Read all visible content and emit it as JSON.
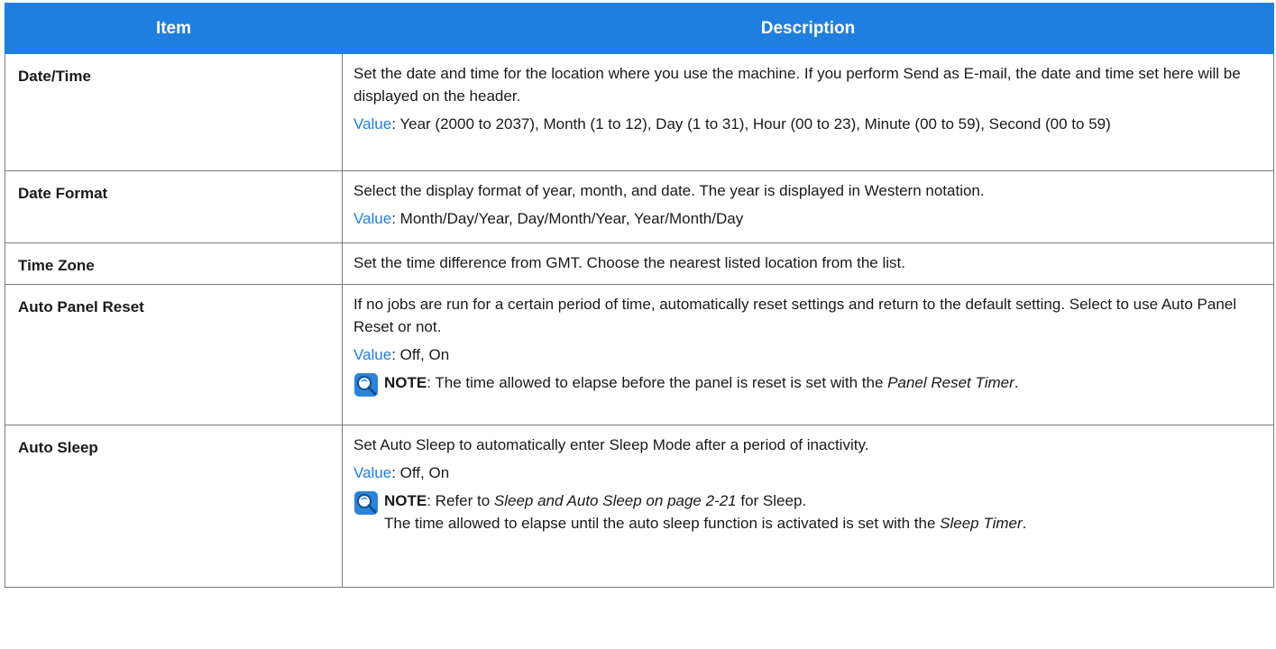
{
  "header": {
    "item": "Item",
    "description": "Description"
  },
  "rows": [
    {
      "item": "Date/Time",
      "text1": "Set the date and time for the location where you use the machine. If you perform Send as E-mail, the date and time set here will be displayed on the header.",
      "value_label": "Value",
      "value": ": Year (2000 to 2037), Month (1 to 12), Day (1 to 31), Hour (00 to 23), Minute (00 to 59), Second (00 to 59)"
    },
    {
      "item": "Date Format",
      "text1": "Select the display format of year, month, and date. The year is displayed in Western notation.",
      "value_label": "Value",
      "value": ": Month/Day/Year, Day/Month/Year, Year/Month/Day"
    },
    {
      "item": "Time Zone",
      "text1": "Set the time difference from GMT. Choose the nearest listed location from the list."
    },
    {
      "item": "Auto Panel Reset",
      "text1": "If no jobs are run for a certain period of time, automatically reset settings and return to the default setting. Select to use Auto Panel Reset or not.",
      "value_label": "Value",
      "value": ": Off, On",
      "note_label": "NOTE",
      "note_pre": ": The time allowed to elapse before the panel is reset is set with the ",
      "note_ref": "Panel Reset Timer",
      "note_post": "."
    },
    {
      "item": "Auto Sleep",
      "text1": "Set Auto Sleep to automatically enter Sleep Mode after a period of inactivity.",
      "value_label": "Value",
      "value": ": Off, On",
      "note_label": "NOTE",
      "note_pre": ": Refer to ",
      "note_ref": "Sleep and Auto Sleep on page 2-21",
      "note_post": " for Sleep.",
      "note2_pre": "The time allowed to elapse until the auto sleep function is activated is set with the ",
      "note2_ref": "Sleep Timer",
      "note2_post": "."
    }
  ],
  "colors": {
    "header_bg": "#1f7fe0",
    "value_label": "#1f7fe0",
    "border": "#7a7a7a"
  },
  "icons": {
    "note": "note-magnifier-icon"
  }
}
